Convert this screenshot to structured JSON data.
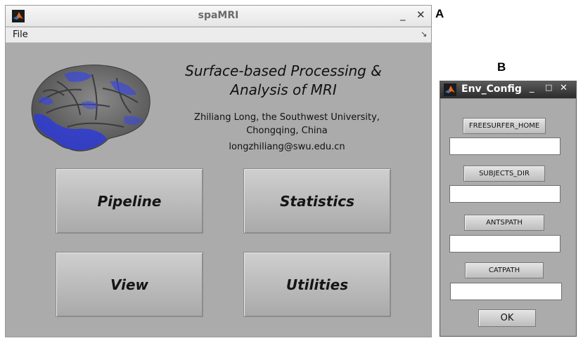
{
  "panel_labels": {
    "a": "A",
    "b": "B"
  },
  "main_window": {
    "title": "spaMRI",
    "logo_icon": "matlab-logo-icon",
    "controls": {
      "minimize": "_",
      "close": "✕"
    },
    "menu": {
      "file": "File",
      "dock_icon": "↘"
    },
    "app_title_line1": "Surface-based Processing &",
    "app_title_line2": "Analysis of MRI",
    "author_line1": "Zhiliang Long, the Southwest University,",
    "author_line2": "Chongqing, China",
    "email": "longzhiliang@swu.edu.cn",
    "buttons": {
      "pipeline": "Pipeline",
      "statistics": "Statistics",
      "view": "View",
      "utilities": "Utilities"
    },
    "colors": {
      "background": "#ababab",
      "brain_cortex": "#6d6d6d",
      "brain_activation": "#2f3bd6"
    }
  },
  "env_window": {
    "title": "Env_Config",
    "controls": {
      "minimize": "_",
      "maximize": "□",
      "close": "✕"
    },
    "fields": [
      {
        "button": "FREESURFER_HOME",
        "value": ""
      },
      {
        "button": "SUBJECTS_DIR",
        "value": ""
      },
      {
        "button": "ANTSPATH",
        "value": ""
      },
      {
        "button": "CATPATH",
        "value": ""
      }
    ],
    "ok_label": "OK"
  }
}
